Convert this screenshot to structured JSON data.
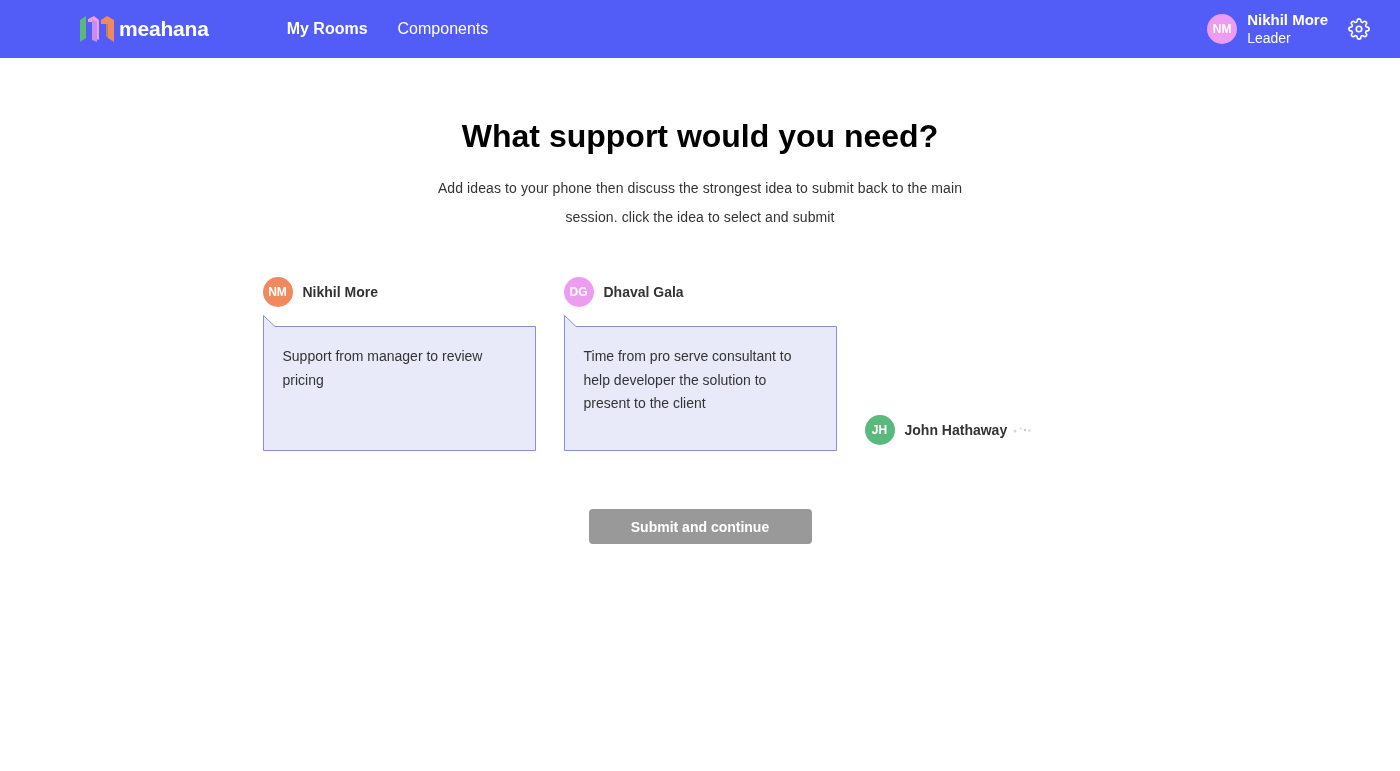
{
  "header": {
    "logo": {
      "text": "meahana"
    },
    "nav": [
      {
        "label": "My Rooms",
        "selected": true
      },
      {
        "label": "Components",
        "selected": false
      }
    ],
    "user": {
      "initials": "NM",
      "color": "#ee9cf1",
      "name": "Nikhil More",
      "role": "Leader"
    }
  },
  "prompt": {
    "title": "What support would you need?",
    "description": "Add ideas to your phone then discuss the strongest idea to submit back to the main session. click the idea to select and submit"
  },
  "participants": [
    {
      "initials": "NM",
      "color": "#ef8a5f",
      "name": "Nikhil More",
      "typing": false,
      "idea": "Support from manager to review pricing"
    },
    {
      "initials": "DG",
      "color": "#ee9cf1",
      "name": "Dhaval Gala",
      "typing": false,
      "idea": "Time from pro serve consultant to help developer the solution to present to the client"
    },
    {
      "initials": "JH",
      "color": "#5ab97c",
      "name": "John Hathaway",
      "typing": true
    }
  ],
  "submit_button": {
    "label": "Submit and continue",
    "disabled": true
  }
}
